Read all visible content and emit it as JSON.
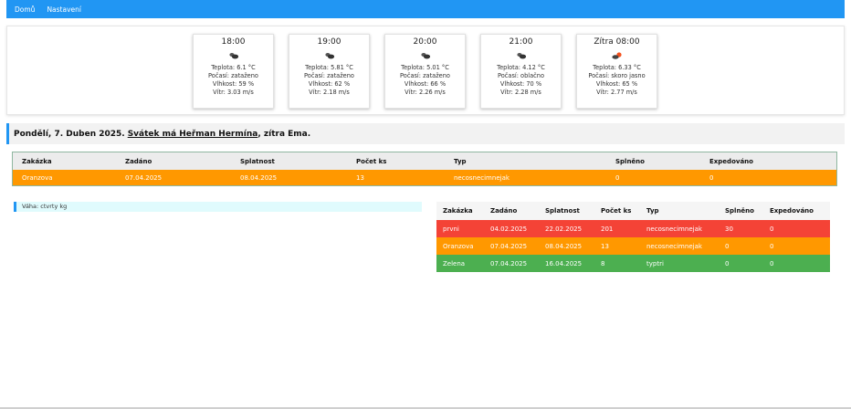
{
  "nav": {
    "items": [
      "Domů",
      "Nastavení"
    ]
  },
  "weather": {
    "cards": [
      {
        "time": "18:00",
        "icon": "cloud-icon",
        "temp": "Teplota: 6.1 °C",
        "sky": "Počasí: zataženo",
        "humidity": "Vlhkost: 59 %",
        "wind": "Vítr: 3.03 m/s"
      },
      {
        "time": "19:00",
        "icon": "cloud-icon",
        "temp": "Teplota: 5.81 °C",
        "sky": "Počasí: zataženo",
        "humidity": "Vlhkost: 62 %",
        "wind": "Vítr: 2.18 m/s"
      },
      {
        "time": "20:00",
        "icon": "cloud-icon",
        "temp": "Teplota: 5.01 °C",
        "sky": "Počasí: zataženo",
        "humidity": "Vlhkost: 66 %",
        "wind": "Vítr: 2.26 m/s"
      },
      {
        "time": "21:00",
        "icon": "cloud-icon",
        "temp": "Teplota: 4.12 °C",
        "sky": "Počasí: oblačno",
        "humidity": "Vlhkost: 70 %",
        "wind": "Vítr: 2.28 m/s"
      },
      {
        "time": "Zítra 08:00",
        "icon": "sun-cloud-icon",
        "temp": "Teplota: 6.33 °C",
        "sky": "Počasí: skoro jasno",
        "humidity": "Vlhkost: 65 %",
        "wind": "Vítr: 2.77 m/s"
      }
    ]
  },
  "date_bar": {
    "prefix": "Pondělí, 7. Duben 2025. ",
    "nameday": "Svátek má Heřman Hermína",
    "suffix": ", zítra Ema."
  },
  "order_table": {
    "headers": [
      "Zakázka",
      "Zadáno",
      "Splatnost",
      "Počet ks",
      "Typ",
      "Splněno",
      "Expedováno"
    ],
    "rows": [
      {
        "cells": [
          "Oranzova",
          "07.04.2025",
          "08.04.2025",
          "13",
          "necosnecimnejak",
          "0",
          "0"
        ],
        "color": "#ff9800"
      }
    ]
  },
  "vaha": {
    "text": "Váha: ctvrty kg"
  },
  "orders_table": {
    "headers": [
      "Zakázka",
      "Zadáno",
      "Splatnost",
      "Počet ks",
      "Typ",
      "Splněno",
      "Expedováno"
    ],
    "rows": [
      {
        "cells": [
          "prvni",
          "04.02.2025",
          "22.02.2025",
          "201",
          "necosnecimnejak",
          "30",
          "0"
        ],
        "color": "#f44336"
      },
      {
        "cells": [
          "Oranzova",
          "07.04.2025",
          "08.04.2025",
          "13",
          "necosnecimnejak",
          "0",
          "0"
        ],
        "color": "#ff9800"
      },
      {
        "cells": [
          "Zelena",
          "07.04.2025",
          "16.04.2025",
          "8",
          "typtri",
          "0",
          "0"
        ],
        "color": "#4caf50"
      }
    ]
  }
}
